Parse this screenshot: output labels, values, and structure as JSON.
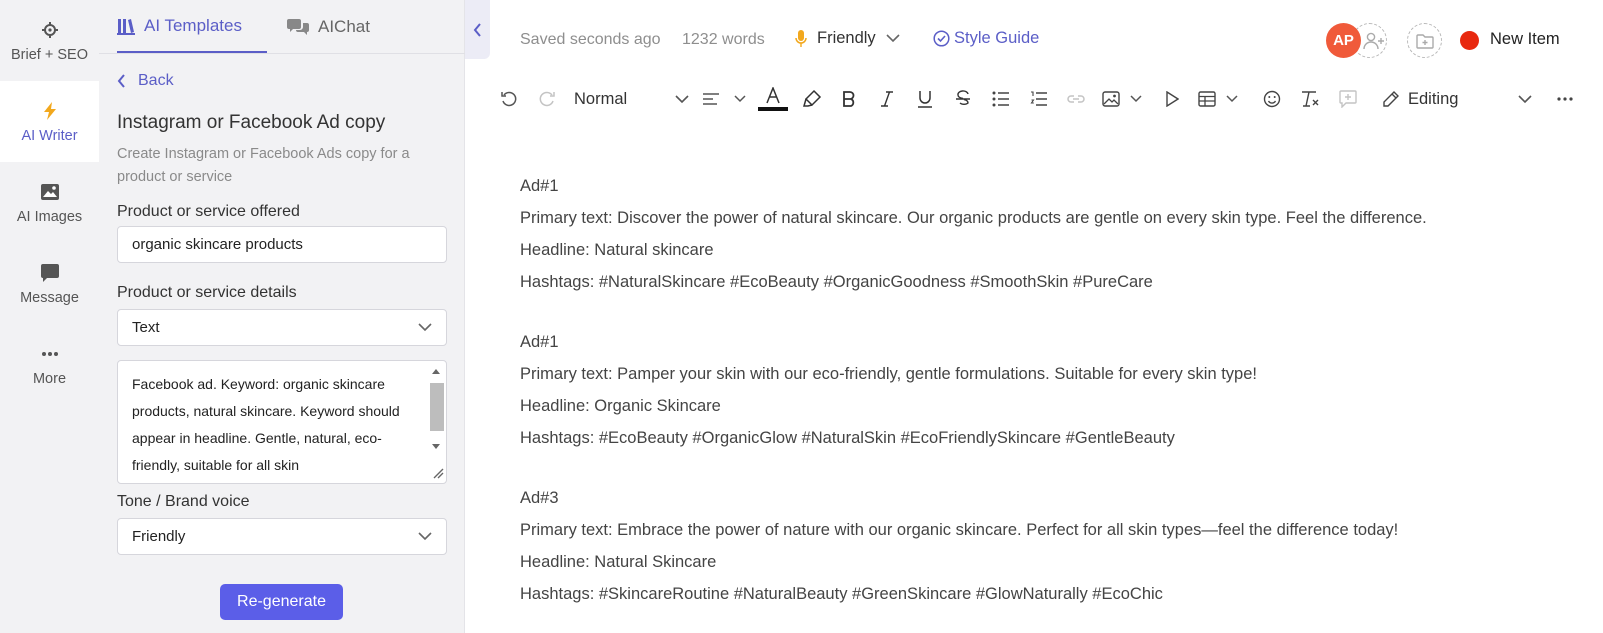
{
  "rail": {
    "items": [
      {
        "label": "Brief + SEO",
        "icon": "crosshair-icon"
      },
      {
        "label": "AI Writer",
        "icon": "lightning-icon"
      },
      {
        "label": "AI Images",
        "icon": "image-icon"
      },
      {
        "label": "Message",
        "icon": "message-icon"
      },
      {
        "label": "More",
        "icon": "more-dots-icon"
      }
    ],
    "active": "AI Writer"
  },
  "panel": {
    "tabs": [
      {
        "label": "AI Templates",
        "active": true
      },
      {
        "label": "AIChat",
        "active": false
      }
    ],
    "back_label": "Back",
    "template_title": "Instagram or Facebook Ad copy",
    "template_desc": "Create Instagram or Facebook Ads copy for a product or service",
    "fields": {
      "product_label": "Product or service offered",
      "product_value": "organic skincare products",
      "details_label": "Product or service details",
      "details_type": "Text",
      "details_text": "Facebook ad. Keyword: organic skincare products, natural skincare. Keyword should appear in headline. Gentle, natural, eco-friendly, suitable for all skin",
      "tone_label": "Tone / Brand voice",
      "tone_value": "Friendly"
    },
    "regenerate_label": "Re-generate"
  },
  "topbar": {
    "saved": "Saved seconds ago",
    "words": "1232 words",
    "tone": "Friendly",
    "style_guide": "Style Guide",
    "avatar_initials": "AP",
    "item_name": "New Item",
    "status_color": "#e8280e"
  },
  "toolbar": {
    "paragraph_style": "Normal",
    "mode": "Editing",
    "text_color": "#111111",
    "accent_color": "#5b5ec7"
  },
  "document": {
    "ads": [
      {
        "title": "Ad#1",
        "primary": "Primary text: Discover the power of natural skincare. Our organic products are gentle on every skin type. Feel the difference.",
        "headline": "Headline: Natural skincare",
        "hashtags": "Hashtags: #NaturalSkincare #EcoBeauty #OrganicGoodness #SmoothSkin #PureCare"
      },
      {
        "title": "Ad#1",
        "primary": "Primary text: Pamper your skin with our eco-friendly, gentle formulations. Suitable for every skin type!",
        "headline": "Headline: Organic Skincare",
        "hashtags": "Hashtags: #EcoBeauty #OrganicGlow #NaturalSkin #EcoFriendlySkincare #GentleBeauty"
      },
      {
        "title": "Ad#3",
        "primary": "Primary text: Embrace the power of nature with our organic skincare. Perfect for all skin types—feel the difference today!",
        "headline": "Headline: Natural Skincare",
        "hashtags": "Hashtags: #SkincareRoutine #NaturalBeauty #GreenSkincare #GlowNaturally #EcoChic"
      }
    ]
  }
}
